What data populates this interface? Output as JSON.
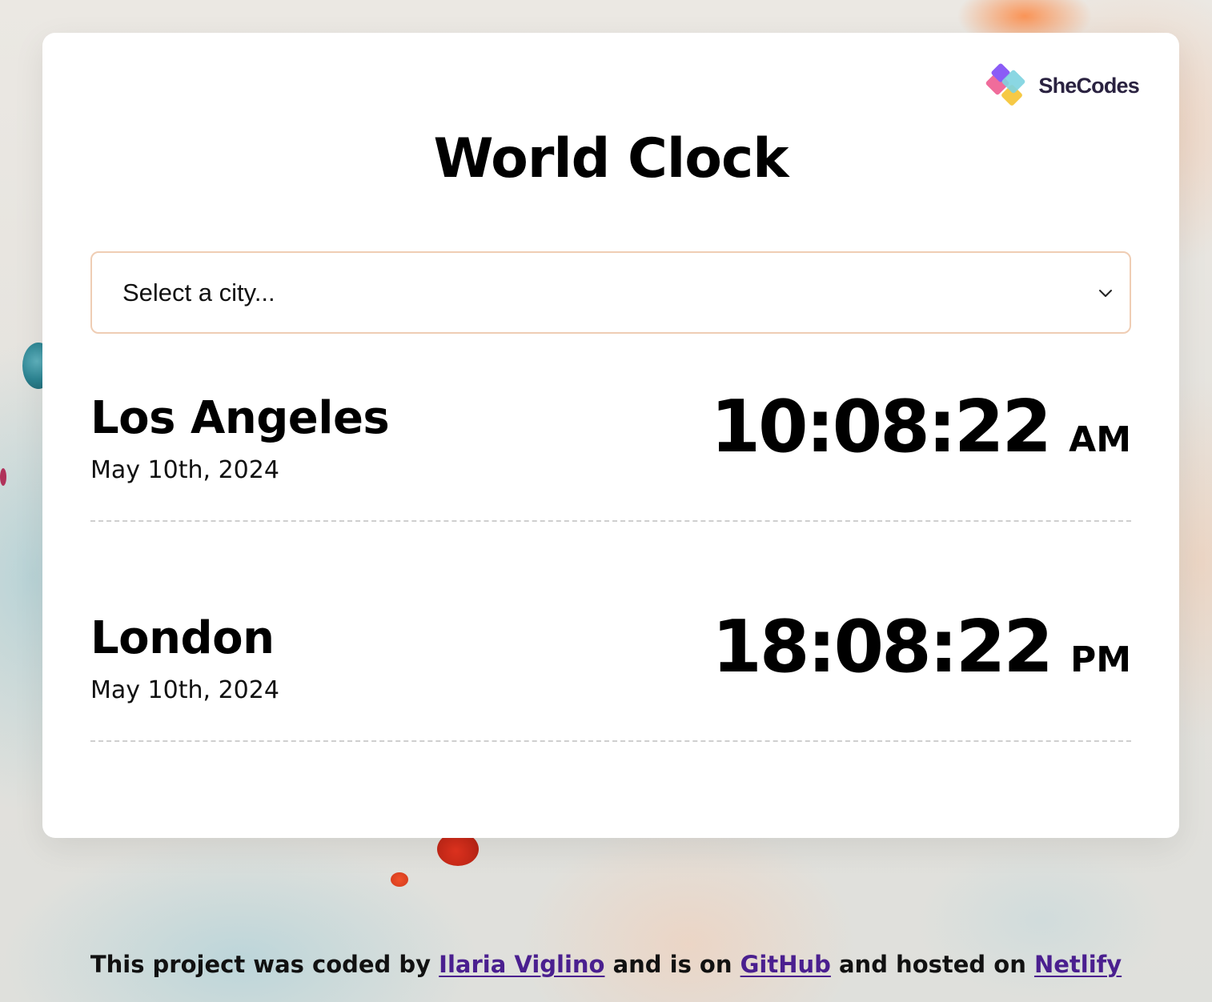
{
  "brand": {
    "name": "SheCodes",
    "icon": "shecodes-logo-icon",
    "colors": [
      "#8b5cf6",
      "#f06c9b",
      "#7dd3e0",
      "#f6c945"
    ]
  },
  "title": "World Clock",
  "select": {
    "value": "Select a city..."
  },
  "cities": [
    {
      "name": "Los Angeles",
      "date": "May 10th, 2024",
      "time": "10:08:22",
      "period": "AM"
    },
    {
      "name": "London",
      "date": "May 10th, 2024",
      "time": "18:08:22",
      "period": "PM"
    }
  ],
  "footer": {
    "text_1": "This project was coded by ",
    "author_link": "Ilaria Viglino",
    "text_2": " and is on ",
    "github_link": "GitHub",
    "text_3": " and hosted on ",
    "netlify_link": "Netlify"
  },
  "colors": {
    "link": "#4a1f8f",
    "select_border": "#efcdb4"
  }
}
